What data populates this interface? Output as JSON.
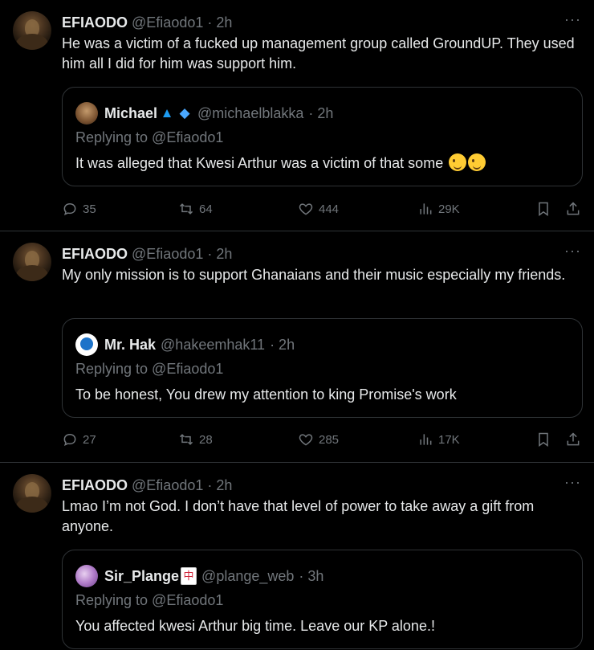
{
  "tweets": [
    {
      "name": "EFIAODO",
      "handle": "@Efiaodo1",
      "time": "· 2h",
      "text": "He was a victim of a fucked up management group  called GroundUP. They used him all I did for him was support him.",
      "quote": {
        "name": "Michael",
        "handle": "@michaelblakka",
        "time": "· 2h",
        "replying": "Replying to @Efiaodo1",
        "text": "It was alleged that Kwesi Arthur was a victim of that  some"
      },
      "stats": {
        "replies": "35",
        "reposts": "64",
        "likes": "444",
        "views": "29K"
      }
    },
    {
      "name": "EFIAODO",
      "handle": "@Efiaodo1",
      "time": "· 2h",
      "text": "My only mission is to support Ghanaians and their music especially my friends.",
      "quote": {
        "name": "Mr. Hak",
        "handle": "@hakeemhak11",
        "time": "· 2h",
        "replying": "Replying to @Efiaodo1",
        "text": "To be honest, You  drew my attention to king Promise's work"
      },
      "stats": {
        "replies": "27",
        "reposts": "28",
        "likes": "285",
        "views": "17K"
      }
    },
    {
      "name": "EFIAODO",
      "handle": "@Efiaodo1",
      "time": "· 2h",
      "text": "Lmao I’m not God. I don’t have that level of power to take away a gift from anyone.",
      "quote": {
        "name": "Sir_Plange",
        "handle": "@plange_web",
        "time": "· 3h",
        "replying": "Replying to @Efiaodo1",
        "text": "You affected kwesi Arthur big time. Leave our KP alone.!"
      }
    }
  ],
  "more_label": "···",
  "icons": [
    "reply-icon",
    "repost-icon",
    "like-icon",
    "views-icon",
    "bookmark-icon",
    "share-icon",
    "more-icon"
  ],
  "colors": {
    "background": "#000000",
    "text": "#e7e9ea",
    "muted": "#71767b",
    "border": "#2f3336"
  }
}
